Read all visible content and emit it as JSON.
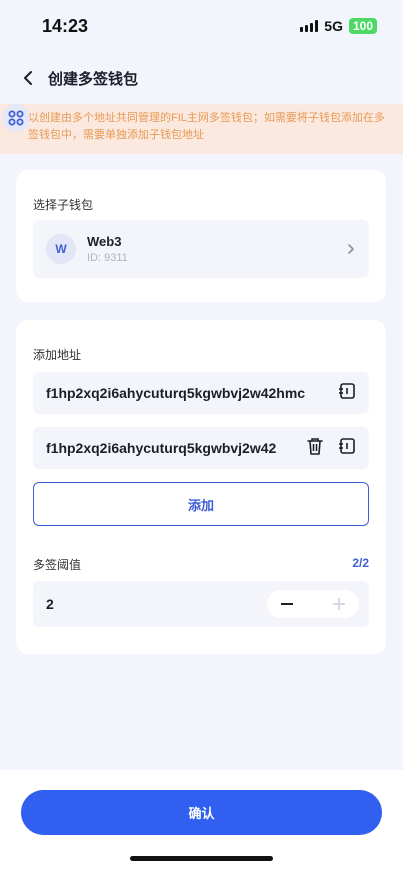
{
  "status": {
    "time": "14:23",
    "network": "5G",
    "battery": "100"
  },
  "nav": {
    "title": "创建多签钱包"
  },
  "notice": {
    "text": "以创建由多个地址共同管理的FIL主网多签钱包；如需要将子钱包添加在多签钱包中，需要单独添加子钱包地址"
  },
  "wallet_section": {
    "label": "选择子钱包",
    "avatar_letter": "W",
    "wallet_name": "Web3",
    "wallet_id": "ID: 9311"
  },
  "address_section": {
    "label": "添加地址",
    "addresses": [
      "f1hp2xq2i6ahycuturq5kgwbvj2w42hmc",
      "f1hp2xq2i6ahycuturq5kgwbvj2w42"
    ],
    "add_button": "添加"
  },
  "threshold": {
    "label": "多签阈值",
    "count": "2/2",
    "value": "2"
  },
  "footer": {
    "confirm": "确认"
  },
  "icons": {
    "back": "chevron-left-icon",
    "float": "apps-icon",
    "chevron": "chevron-right-icon",
    "paste": "paste-icon",
    "delete": "trash-icon"
  },
  "colors": {
    "primary": "#3160f0",
    "accent": "#3f5ed6",
    "notice_bg": "#fbe9df",
    "notice_text": "#e79a55"
  }
}
